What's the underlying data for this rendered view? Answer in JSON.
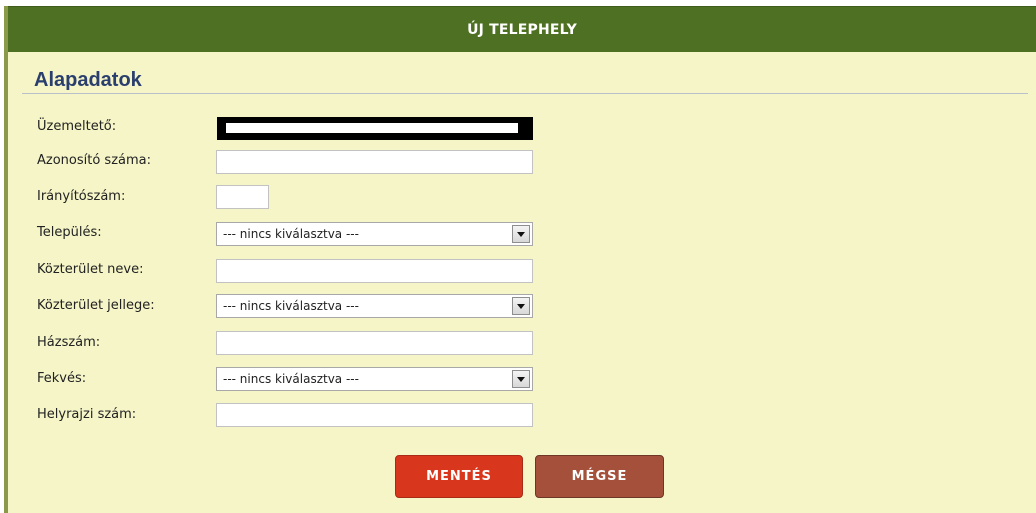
{
  "dialog": {
    "title": "ÚJ TELEPHELY",
    "section_title": "Alapadatok"
  },
  "form": {
    "fields": [
      {
        "label": "Üzemeltető:",
        "type": "redacted",
        "value": ""
      },
      {
        "label": "Azonosító száma:",
        "type": "text",
        "value": ""
      },
      {
        "label": "Irányítószám:",
        "type": "text",
        "value": ""
      },
      {
        "label": "Település:",
        "type": "select",
        "value": "--- nincs kiválasztva ---"
      },
      {
        "label": "Közterület neve:",
        "type": "text",
        "value": ""
      },
      {
        "label": "Közterület jellege:",
        "type": "select",
        "value": "--- nincs kiválasztva ---"
      },
      {
        "label": "Házszám:",
        "type": "text",
        "value": ""
      },
      {
        "label": "Fekvés:",
        "type": "select",
        "value": "--- nincs kiválasztva ---"
      },
      {
        "label": "Helyrajzi szám:",
        "type": "text",
        "value": ""
      }
    ]
  },
  "buttons": {
    "save_label": "MENTÉS",
    "cancel_label": "MÉGSE"
  },
  "colors": {
    "header_bg": "#4e7022",
    "panel_bg": "#f5f5c8",
    "section_title": "#2b3f6e",
    "save_button": "#d9361e",
    "cancel_button": "#a4503a"
  }
}
